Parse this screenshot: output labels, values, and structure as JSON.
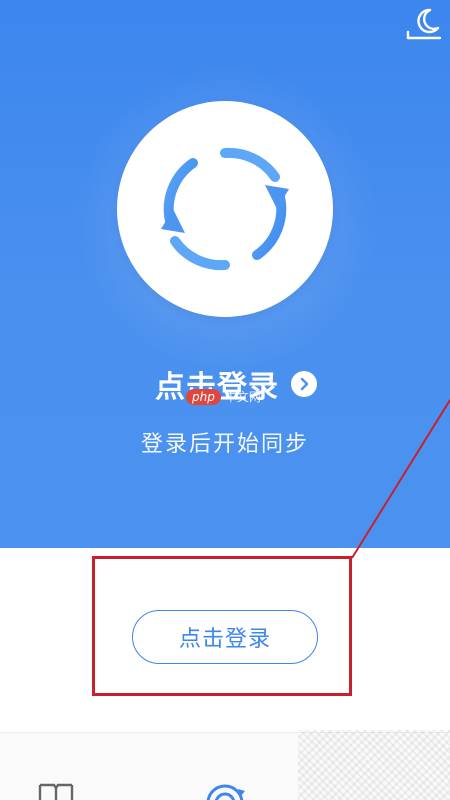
{
  "header": {
    "night_mode_icon": "moon-icon"
  },
  "profile": {
    "avatar_icon": "sync-circle-icon",
    "login_title": "点击登录",
    "chevron_icon": "chevron-right-icon",
    "subtitle": "登录后开始同步"
  },
  "watermark": {
    "badge": "php",
    "text": "中文网"
  },
  "login_section": {
    "button_label": "点击登录"
  },
  "tabbar": {
    "items": [
      {
        "icon": "book-icon"
      },
      {
        "icon": "sync-icon"
      }
    ]
  },
  "colors": {
    "accent": "#3c86ee",
    "annotation": "#c8202e"
  }
}
